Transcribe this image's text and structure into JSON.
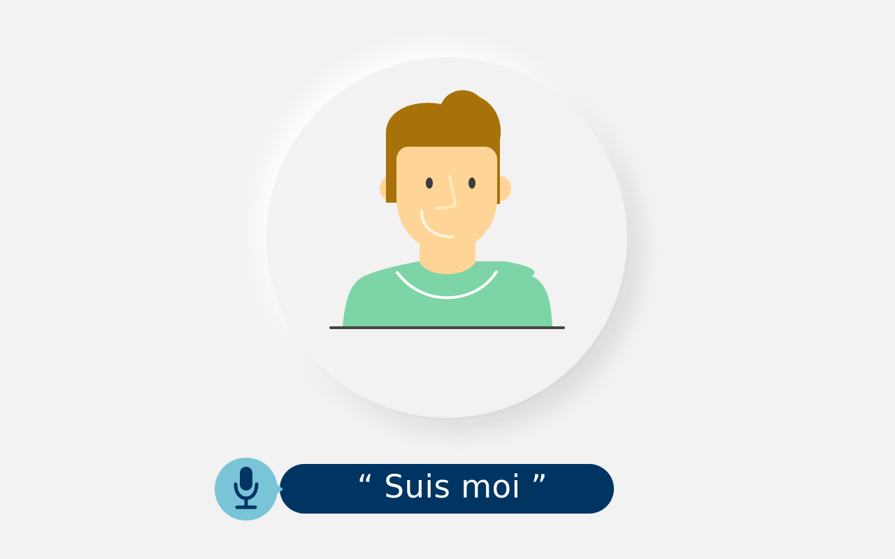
{
  "command": {
    "text": "“ Suis moi ”",
    "icon": "microphone-icon"
  },
  "colors": {
    "background": "#f2f2f2",
    "hair": "#a8720b",
    "skin": "#ffd597",
    "shirt": "#7dd4a6",
    "pill": "#003563",
    "mic_badge": "#79c4d7",
    "mic_icon": "#003563"
  }
}
